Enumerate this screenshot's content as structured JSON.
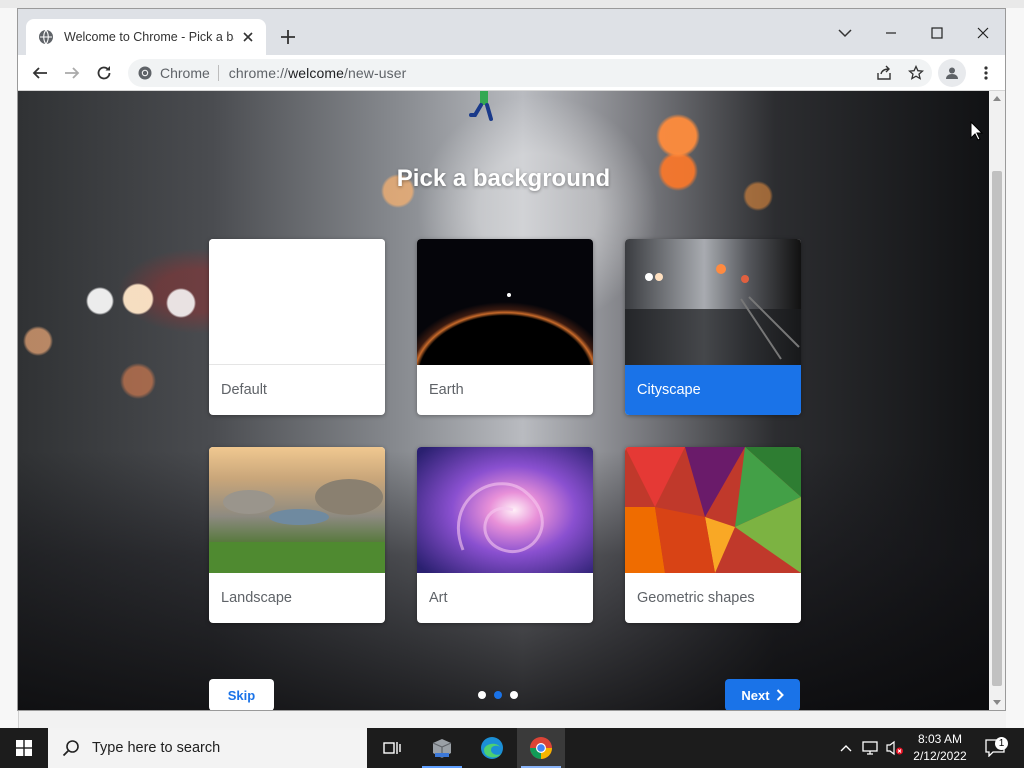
{
  "browser": {
    "tab_title": "Welcome to Chrome - Pick a background",
    "omnibox_chip": "Chrome",
    "url_prefix": "chrome://",
    "url_host": "welcome",
    "url_path": "/new-user"
  },
  "page": {
    "heading": "Pick a background",
    "backgrounds": [
      {
        "label": "Default",
        "selected": false
      },
      {
        "label": "Earth",
        "selected": false
      },
      {
        "label": "Cityscape",
        "selected": true
      },
      {
        "label": "Landscape",
        "selected": false
      },
      {
        "label": "Art",
        "selected": false
      },
      {
        "label": "Geometric shapes",
        "selected": false
      }
    ],
    "skip_label": "Skip",
    "next_label": "Next",
    "step_count": 3,
    "current_step": 2
  },
  "taskbar": {
    "search_placeholder": "Type here to search",
    "time": "8:03 AM",
    "date": "2/12/2022",
    "notification_count": "1"
  },
  "colors": {
    "accent": "#1a73e8",
    "taskbar": "#1c1c1c"
  }
}
